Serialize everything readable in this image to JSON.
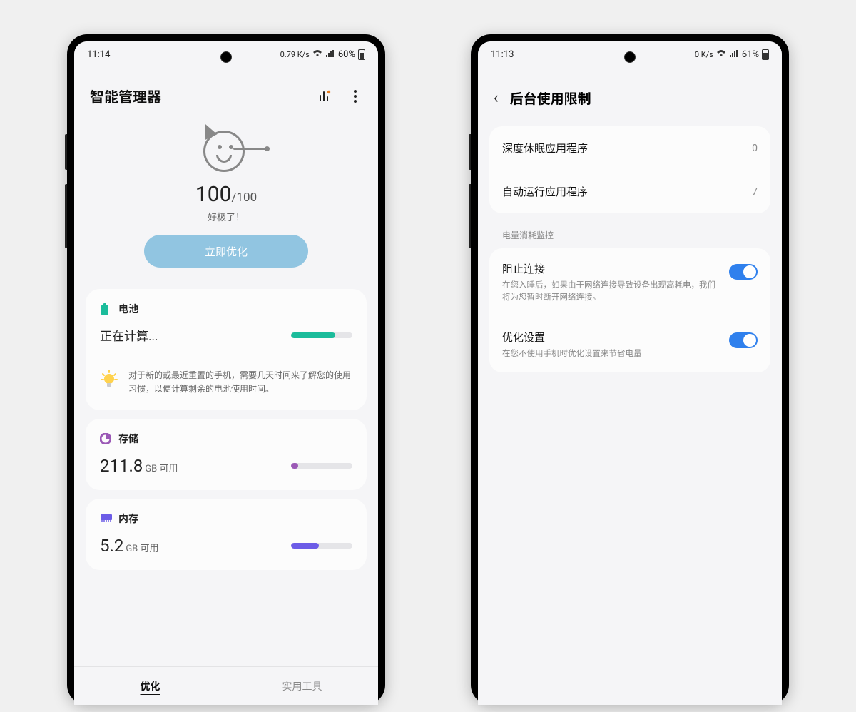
{
  "left": {
    "status": {
      "time": "11:14",
      "speed": "0.79 K/s",
      "battery_pct": "60%"
    },
    "title": "智能管理器",
    "score": {
      "value": "100",
      "max": "/100",
      "subtitle": "好极了！"
    },
    "optimize_btn": "立即优化",
    "battery": {
      "label": "电池",
      "status_text": "正在计算...",
      "tip": "对于新的或最近重置的手机，需要几天时间来了解您的使用习惯，以便计算剩余的电池使用时间。"
    },
    "storage": {
      "label": "存储",
      "value": "211.8",
      "unit": "GB 可用"
    },
    "memory": {
      "label": "内存",
      "value": "5.2",
      "unit": "GB 可用"
    },
    "tabs": {
      "optimize": "优化",
      "tools": "实用工具"
    }
  },
  "right": {
    "status": {
      "time": "11:13",
      "speed": "0 K/s",
      "battery_pct": "61%"
    },
    "title": "后台使用限制",
    "items": [
      {
        "label": "深度休眠应用程序",
        "value": "0"
      },
      {
        "label": "自动运行应用程序",
        "value": "7"
      }
    ],
    "section": "电量消耗监控",
    "toggles": [
      {
        "title": "阻止连接",
        "desc": "在您入睡后，如果由于网络连接导致设备出现高耗电，我们将为您暂时断开网络连接。"
      },
      {
        "title": "优化设置",
        "desc": "在您不使用手机时优化设置来节省电量"
      }
    ]
  }
}
